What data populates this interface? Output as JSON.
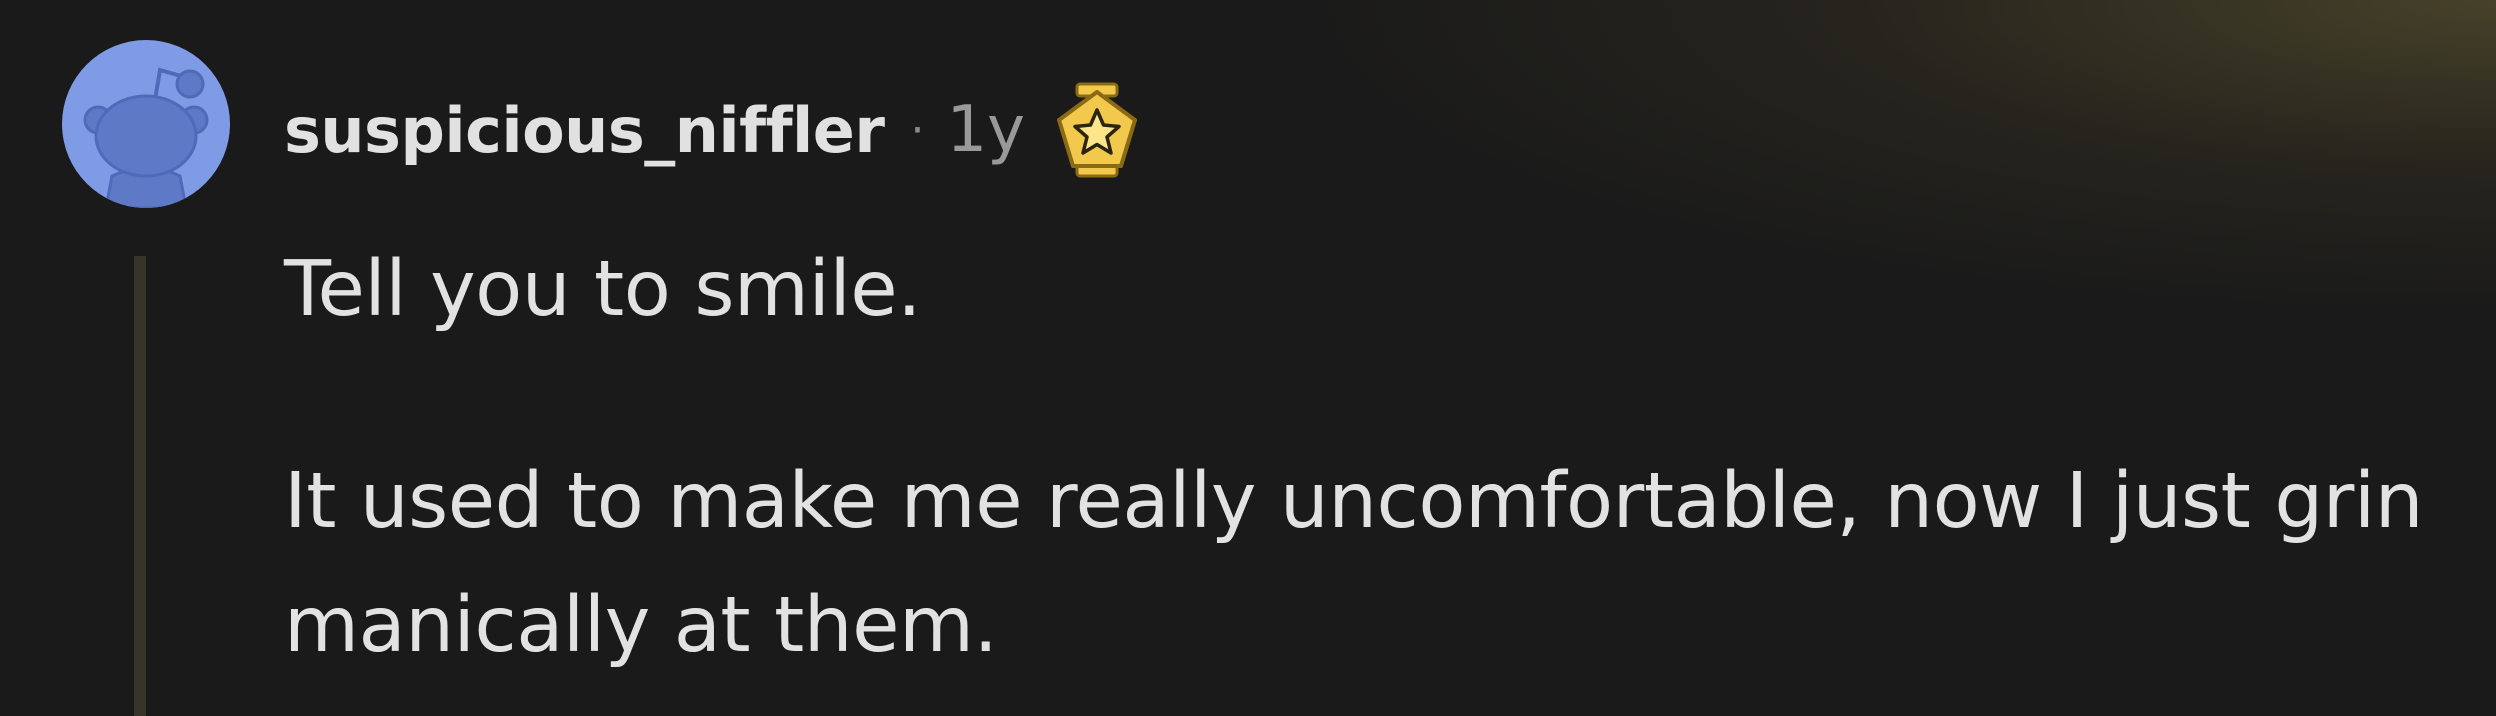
{
  "comment": {
    "author": "suspicious_niffler",
    "separator": "·",
    "age": "1y",
    "avatar_icon": "snoo-avatar-icon",
    "award_icon": "star-award-icon",
    "paragraphs": [
      "Tell you to smile.",
      "It used to make me really uncomfortable, now I just grin manically at them."
    ]
  },
  "colors": {
    "background": "#1a1a1a",
    "avatar_bg": "#7f9be6",
    "text": "#e2e2e2",
    "meta": "#999999",
    "thread_line": "#36352a",
    "award_gold": "#f2c94c"
  }
}
